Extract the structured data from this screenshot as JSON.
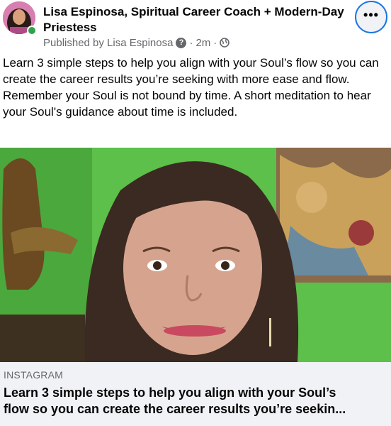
{
  "post": {
    "author": "Lisa Espinosa, Spiritual Career Coach + Modern-Day Priestess",
    "published_by": "Published by Lisa Espinosa",
    "question_icon": "?",
    "separator": "·",
    "time": "2m",
    "audience_icon": "globe-icon",
    "more_icon": "•••",
    "text_lines": [
      "Learn 3 simple steps to help you align with your Soul’s flow so you can create the career results you’re seeking with more ease and flow.",
      "Remember your Soul is not bound by time. A short meditation to hear your Soul's guidance about time is included."
    ]
  },
  "link_card": {
    "source": "INSTAGRAM",
    "title_line1": "Learn 3 simple steps to help you align with your Soul’s",
    "title_line2": "flow so you can create the career results you’re seekin..."
  },
  "colors": {
    "online": "#31a24c",
    "focus_ring": "#1b74e4",
    "background_wall": "#5cc04a",
    "card_bg": "#f0f2f5",
    "meta_text": "#65676b"
  }
}
